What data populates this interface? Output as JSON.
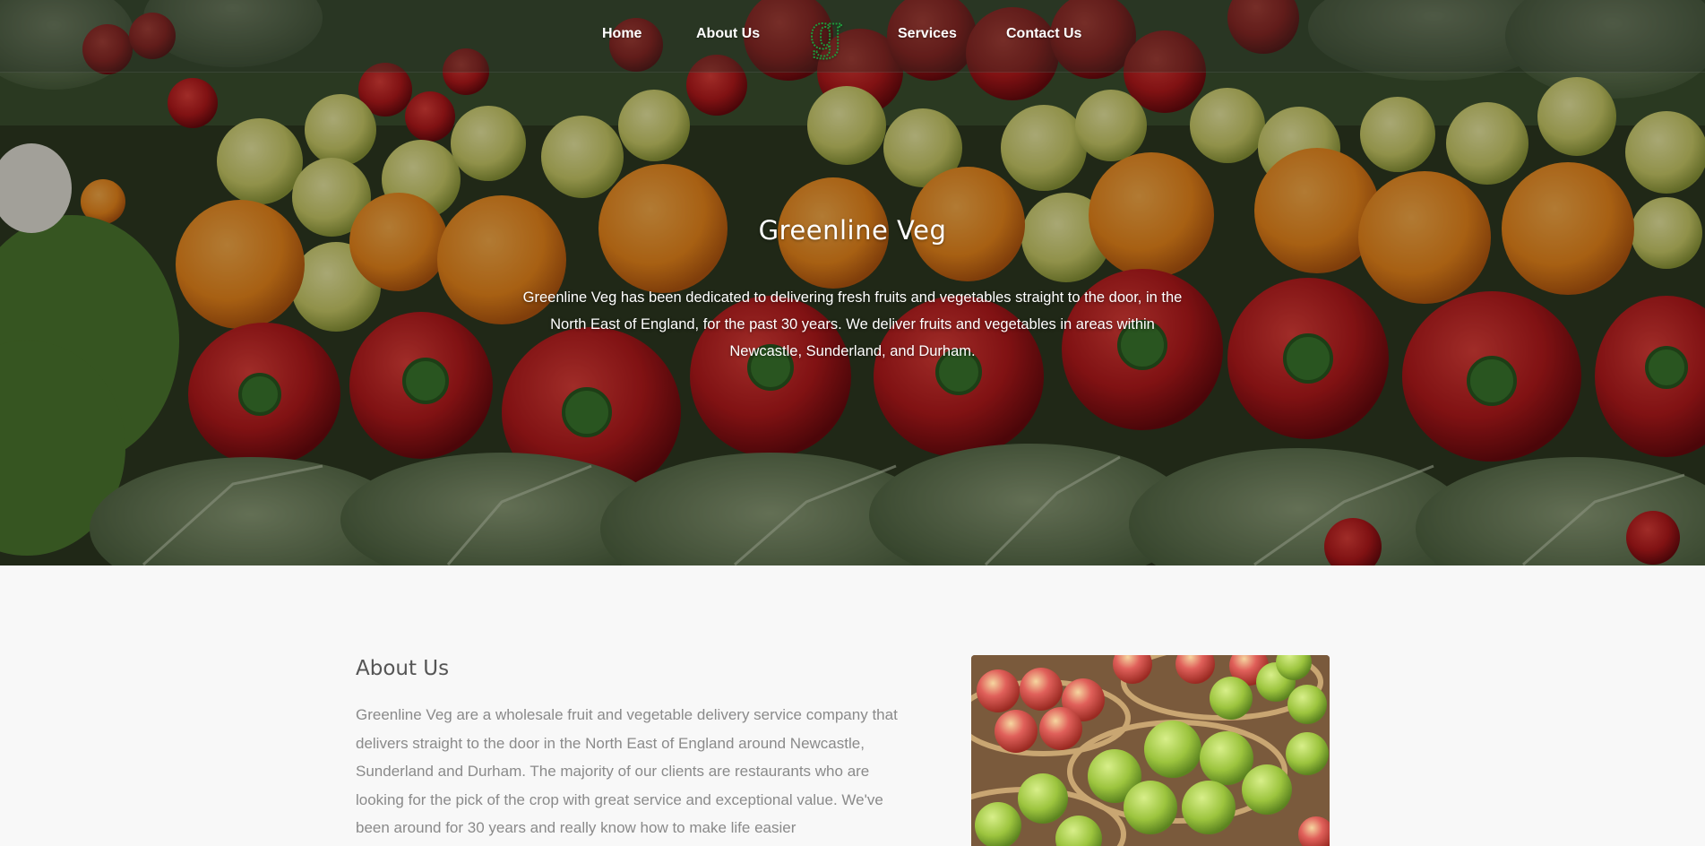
{
  "nav": {
    "items": [
      {
        "label": "Home"
      },
      {
        "label": "About Us"
      },
      {
        "label": "Services"
      },
      {
        "label": "Contact Us"
      }
    ],
    "logo_letter": "g"
  },
  "hero": {
    "title": "Greenline Veg",
    "description": "Greenline Veg has been dedicated to delivering fresh fruits and vegetables straight to the door, in the North East of England, for the past 30 years. We deliver fruits and vegetables in areas within Newcastle, Sunderland, and Durham."
  },
  "about": {
    "title": "About Us",
    "text": "Greenline Veg are a wholesale fruit and vegetable delivery service company that delivers straight to the door in the North East of England around Newcastle, Sunderland and Durham. The majority of our clients are restaurants who are looking for the pick of the crop with great service and exceptional value. We've been around for 30 years and really know how to make life easier"
  },
  "colors": {
    "logo_green": "#1f9a3c",
    "about_text": "#8a8a8a",
    "about_title": "#555555",
    "background": "#f8f8f8"
  }
}
